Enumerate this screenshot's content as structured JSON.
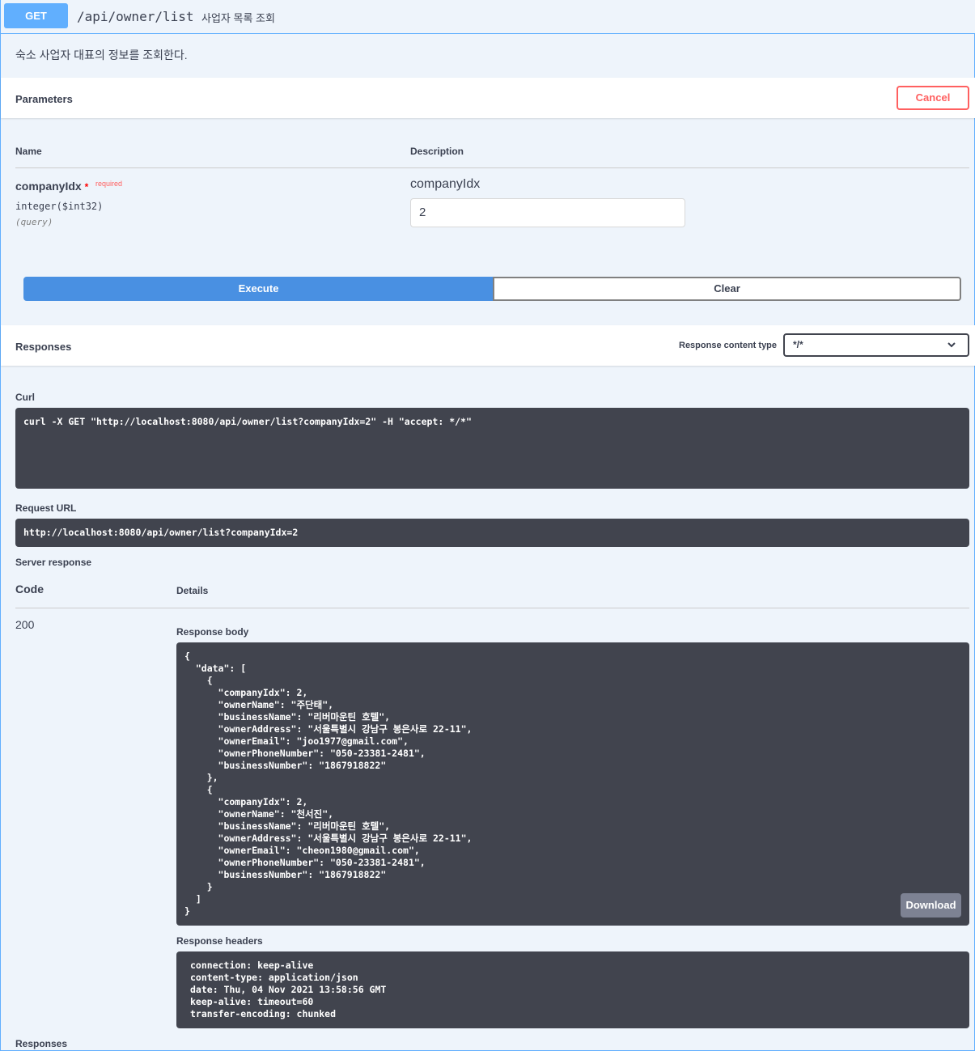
{
  "operation": {
    "method": "GET",
    "path": "/api/owner/list",
    "summary": "사업자 목록 조회",
    "description": "숙소 사업자 대표의 정보를 조회한다."
  },
  "parameters": {
    "title": "Parameters",
    "cancel_label": "Cancel",
    "col_name": "Name",
    "col_description": "Description",
    "items": [
      {
        "name": "companyIdx",
        "star": "*",
        "required": "required",
        "type": "integer($int32)",
        "in": "(query)",
        "description": "companyIdx",
        "value": "2"
      }
    ],
    "execute_label": "Execute",
    "clear_label": "Clear"
  },
  "responses": {
    "title": "Responses",
    "content_type_label": "Response content type",
    "content_type_value": "*/*",
    "curl_label": "Curl",
    "curl": "curl -X GET \"http://localhost:8080/api/owner/list?companyIdx=2\" -H \"accept: */*\"",
    "request_url_label": "Request URL",
    "request_url": "http://localhost:8080/api/owner/list?companyIdx=2",
    "server_response_label": "Server response",
    "code_header": "Code",
    "details_header": "Details",
    "code": "200",
    "body_label": "Response body",
    "body_lines": [
      "{",
      "  \"data\": [",
      "    {",
      "      \"companyIdx\": 2,",
      "      \"ownerName\": \"주단태\",",
      "      \"businessName\": \"리버마운틴 호텔\",",
      "      \"ownerAddress\": \"서울특별시 강남구 봉은사로 22-11\",",
      "      \"ownerEmail\": \"joo1977@gmail.com\",",
      "      \"ownerPhoneNumber\": \"050-23381-2481\",",
      "      \"businessNumber\": \"1867918822\"",
      "    },",
      "    {",
      "      \"companyIdx\": 2,",
      "      \"ownerName\": \"천서진\",",
      "      \"businessName\": \"리버마운틴 호텔\",",
      "      \"ownerAddress\": \"서울특별시 강남구 봉은사로 22-11\",",
      "      \"ownerEmail\": \"cheon1980@gmail.com\",",
      "      \"ownerPhoneNumber\": \"050-23381-2481\",",
      "      \"businessNumber\": \"1867918822\"",
      "    }",
      "  ]",
      "}"
    ],
    "download_label": "Download",
    "headers_label": "Response headers",
    "header_lines": [
      "connection: keep-alive",
      "content-type: application/json",
      "date: Thu, 04 Nov 2021 13:58:56 GMT",
      "keep-alive: timeout=60",
      "transfer-encoding: chunked"
    ],
    "footer_title": "Responses"
  },
  "colors": {
    "get_blue": "#61affe",
    "execute_blue": "#4990e2",
    "cancel_red": "#ff6060",
    "code_bg": "#41444e"
  }
}
